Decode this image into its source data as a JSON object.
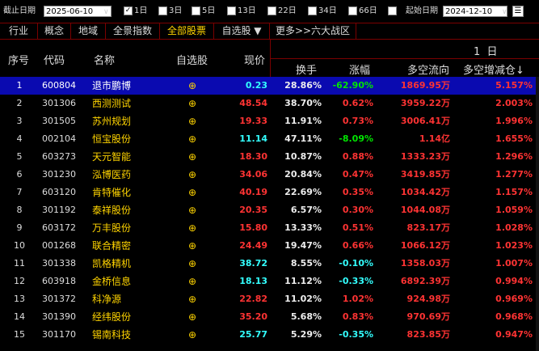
{
  "toolbar": {
    "end_date_label": "截止日期",
    "end_date_value": "2025-06-10",
    "periods": [
      {
        "label": "1日",
        "checked": true
      },
      {
        "label": "3日",
        "checked": false
      },
      {
        "label": "5日",
        "checked": false
      },
      {
        "label": "13日",
        "checked": false
      },
      {
        "label": "22日",
        "checked": false
      },
      {
        "label": "34日",
        "checked": false
      },
      {
        "label": "66日",
        "checked": false
      },
      {
        "label": "",
        "checked": false
      }
    ],
    "start_date_label": "起始日期",
    "start_date_value": "2024-12-10"
  },
  "tabs": [
    {
      "label": "行业",
      "active": false
    },
    {
      "label": "概念",
      "active": false
    },
    {
      "label": "地域",
      "active": false
    },
    {
      "label": "全景指数",
      "active": false
    },
    {
      "label": "全部股票",
      "active": true
    },
    {
      "label": "自选股 ▼",
      "active": false
    },
    {
      "label": "更多>>六大战区",
      "active": false
    }
  ],
  "header": {
    "seq": "序号",
    "code": "代码",
    "name": "名称",
    "watch": "自选股",
    "price": "现价",
    "period": "1  日",
    "turnover": "换手",
    "change": "涨幅",
    "flow": "多空流向",
    "increase": "多空增减仓↓"
  },
  "rows": [
    {
      "no": "1",
      "code": "600804",
      "name": "退市鹏博",
      "price": "0.23",
      "price_color": "cyan",
      "turnover": "28.86%",
      "change": "-62.90%",
      "change_color": "grn",
      "flow": "1869.95万",
      "increase": "5.157%",
      "selected": true
    },
    {
      "no": "2",
      "code": "301306",
      "name": "西测测试",
      "price": "48.54",
      "price_color": "red",
      "turnover": "38.70%",
      "change": "0.62%",
      "change_color": "red",
      "flow": "3959.22万",
      "increase": "2.003%"
    },
    {
      "no": "3",
      "code": "301505",
      "name": "苏州规划",
      "price": "19.33",
      "price_color": "red",
      "turnover": "11.91%",
      "change": "0.73%",
      "change_color": "red",
      "flow": "3006.41万",
      "increase": "1.996%"
    },
    {
      "no": "4",
      "code": "002104",
      "name": "恒宝股份",
      "price": "11.14",
      "price_color": "cyan",
      "turnover": "47.11%",
      "change": "-8.09%",
      "change_color": "grn",
      "flow": "1.14亿",
      "increase": "1.655%"
    },
    {
      "no": "5",
      "code": "603273",
      "name": "天元智能",
      "price": "18.30",
      "price_color": "red",
      "turnover": "10.87%",
      "change": "0.88%",
      "change_color": "red",
      "flow": "1333.23万",
      "increase": "1.296%"
    },
    {
      "no": "6",
      "code": "301230",
      "name": "泓博医药",
      "price": "34.06",
      "price_color": "red",
      "turnover": "20.84%",
      "change": "0.47%",
      "change_color": "red",
      "flow": "3419.85万",
      "increase": "1.277%"
    },
    {
      "no": "7",
      "code": "603120",
      "name": "肯特催化",
      "price": "40.19",
      "price_color": "red",
      "turnover": "22.69%",
      "change": "0.35%",
      "change_color": "red",
      "flow": "1034.42万",
      "increase": "1.157%"
    },
    {
      "no": "8",
      "code": "301192",
      "name": "泰祥股份",
      "price": "20.35",
      "price_color": "red",
      "turnover": "6.57%",
      "change": "0.30%",
      "change_color": "red",
      "flow": "1044.08万",
      "increase": "1.059%"
    },
    {
      "no": "9",
      "code": "603172",
      "name": "万丰股份",
      "price": "15.80",
      "price_color": "red",
      "turnover": "13.33%",
      "change": "0.51%",
      "change_color": "red",
      "flow": "823.17万",
      "increase": "1.028%"
    },
    {
      "no": "10",
      "code": "001268",
      "name": "联合精密",
      "price": "24.49",
      "price_color": "red",
      "turnover": "19.47%",
      "change": "0.66%",
      "change_color": "red",
      "flow": "1066.12万",
      "increase": "1.023%"
    },
    {
      "no": "11",
      "code": "301338",
      "name": "凯格精机",
      "price": "38.72",
      "price_color": "cyan",
      "turnover": "8.55%",
      "change": "-0.10%",
      "change_color": "cyan",
      "flow": "1358.03万",
      "increase": "1.007%"
    },
    {
      "no": "12",
      "code": "603918",
      "name": "金桥信息",
      "price": "18.13",
      "price_color": "cyan",
      "turnover": "11.12%",
      "change": "-0.33%",
      "change_color": "cyan",
      "flow": "6892.39万",
      "increase": "0.994%"
    },
    {
      "no": "13",
      "code": "301372",
      "name": "科净源",
      "price": "22.82",
      "price_color": "red",
      "turnover": "11.02%",
      "change": "1.02%",
      "change_color": "red",
      "flow": "924.98万",
      "increase": "0.969%"
    },
    {
      "no": "14",
      "code": "301390",
      "name": "经纬股份",
      "price": "35.20",
      "price_color": "red",
      "turnover": "5.68%",
      "change": "0.83%",
      "change_color": "red",
      "flow": "970.69万",
      "increase": "0.968%"
    },
    {
      "no": "15",
      "code": "301170",
      "name": "锡南科技",
      "price": "25.77",
      "price_color": "cyan",
      "turnover": "5.29%",
      "change": "-0.35%",
      "change_color": "cyan",
      "flow": "823.85万",
      "increase": "0.947%"
    }
  ]
}
